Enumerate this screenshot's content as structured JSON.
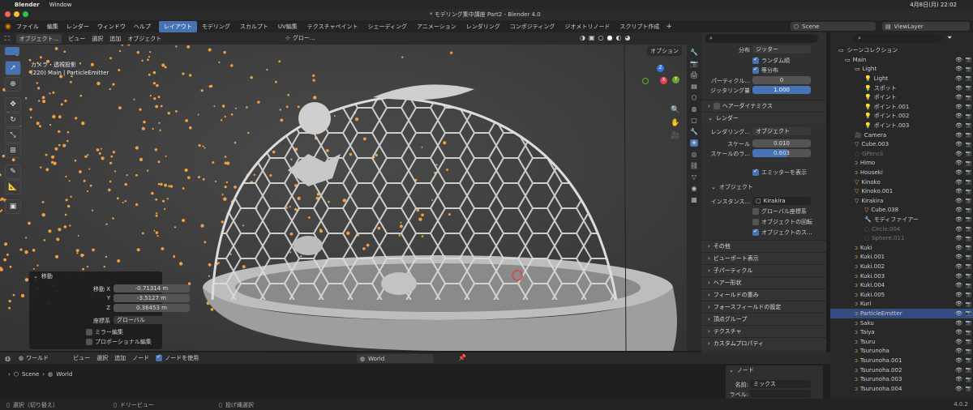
{
  "macbar": {
    "app": "Blender",
    "menu": "Window",
    "clock": "4月8日(月) 22:02"
  },
  "title": "* モデリング集中講座 Part2 - Blender 4.0",
  "topmenu": [
    "ファイル",
    "編集",
    "レンダー",
    "ウィンドウ",
    "ヘルプ"
  ],
  "workspaces": [
    "レイアウト",
    "モデリング",
    "スカルプト",
    "UV編集",
    "テクスチャペイント",
    "シェーディング",
    "アニメーション",
    "レンダリング",
    "コンポジティング",
    "ジオメトリノード",
    "スクリプト作成"
  ],
  "active_workspace": "レイアウト",
  "scene": "Scene",
  "viewlayer": "ViewLayer",
  "viewport": {
    "mode": "オブジェクト...",
    "menu": [
      "ビュー",
      "選択",
      "追加",
      "オブジェクト"
    ],
    "transform": "グロー...",
    "overlay_label": "オプション",
    "info1": "カメラ・透視投影",
    "info2": "(220) Main | ParticleEmitter",
    "gizmo_x": "X",
    "gizmo_y": "Y",
    "gizmo_z": "Z"
  },
  "redo": {
    "title": "移動",
    "label_move": "移動 X",
    "x": "-0.71314 m",
    "label_y": "Y",
    "y": "-3.5127 m",
    "label_z": "Z",
    "z": "0.36453 m",
    "orient_label": "座標系",
    "orient": "グローバル",
    "mirror": "ミラー編集",
    "proportional": "プロポーショナル編集"
  },
  "props": {
    "dist_label": "分布",
    "dist": "ジッター",
    "random": "ランダム順",
    "even": "等分布",
    "per_label": "パーティクル...",
    "per_val": "0",
    "jitter_label": "ジッタリング量",
    "jitter_val": "1.000",
    "hair": "ヘアーダイナミクス",
    "render": "レンダー",
    "renderas_label": "レンダリング...",
    "renderas": "オブジェクト",
    "scale_label": "スケール",
    "scale_val": "0.010",
    "scalernd_label": "スケールのラ...",
    "scalernd_val": "0.603",
    "show_emitter": "エミッターを表示",
    "object_sec": "オブジェクト",
    "inst_label": "インスタンス...",
    "inst_val": "Kirakira",
    "global": "グローバル座標系",
    "rotation": "オブジェクトの回転",
    "objscale": "オブジェクトのス...",
    "panels": [
      "その他",
      "ビューポート表示",
      "子パーティクル",
      "ヘアー形状",
      "フィールドの重み",
      "フォースフィールドの設定",
      "頂点グループ",
      "テクスチャ",
      "カスタムプロパティ"
    ]
  },
  "outliner": {
    "root": "シーンコレクション",
    "rows": [
      {
        "t": "Main",
        "d": 0,
        "k": "col"
      },
      {
        "t": "Light",
        "d": 1,
        "k": "col"
      },
      {
        "t": "Light",
        "d": 2,
        "k": "lt"
      },
      {
        "t": "スポット",
        "d": 2,
        "k": "lt"
      },
      {
        "t": "ポイント",
        "d": 2,
        "k": "lt"
      },
      {
        "t": "ポイント.001",
        "d": 2,
        "k": "lt"
      },
      {
        "t": "ポイント.002",
        "d": 2,
        "k": "lt"
      },
      {
        "t": "ポイント.003",
        "d": 2,
        "k": "lt"
      },
      {
        "t": "Camera",
        "d": 1,
        "k": "cam"
      },
      {
        "t": "Cube.003",
        "d": 1,
        "k": "obj"
      },
      {
        "t": "GPencil",
        "d": 1,
        "k": "dim"
      },
      {
        "t": "Himo",
        "d": 1,
        "k": "crv"
      },
      {
        "t": "Houseki",
        "d": 1,
        "k": "crv"
      },
      {
        "t": "Kinoko",
        "d": 1,
        "k": "obj"
      },
      {
        "t": "Kinoko.001",
        "d": 1,
        "k": "obj"
      },
      {
        "t": "Kirakira",
        "d": 1,
        "k": "obj"
      },
      {
        "t": "Cube.038",
        "d": 2,
        "k": "obj"
      },
      {
        "t": "モディファイアー",
        "d": 2,
        "k": "mod"
      },
      {
        "t": "Circle.004",
        "d": 2,
        "k": "dim"
      },
      {
        "t": "Sphere.011",
        "d": 2,
        "k": "dim"
      },
      {
        "t": "Kuki",
        "d": 1,
        "k": "crv"
      },
      {
        "t": "Kuki.001",
        "d": 1,
        "k": "crv"
      },
      {
        "t": "Kuki.002",
        "d": 1,
        "k": "crv"
      },
      {
        "t": "Kuki.003",
        "d": 1,
        "k": "crv"
      },
      {
        "t": "Kuki.004",
        "d": 1,
        "k": "crv"
      },
      {
        "t": "Kuki.005",
        "d": 1,
        "k": "crv"
      },
      {
        "t": "Kuri",
        "d": 1,
        "k": "crv"
      },
      {
        "t": "ParticleEmitter",
        "d": 1,
        "k": "sel"
      },
      {
        "t": "Saku",
        "d": 1,
        "k": "crv"
      },
      {
        "t": "Taiya",
        "d": 1,
        "k": "crv"
      },
      {
        "t": "Tsuru",
        "d": 1,
        "k": "crv"
      },
      {
        "t": "Tsurunoha",
        "d": 1,
        "k": "crv"
      },
      {
        "t": "Tsurunoha.001",
        "d": 1,
        "k": "crv"
      },
      {
        "t": "Tsurunoha.002",
        "d": 1,
        "k": "crv"
      },
      {
        "t": "Tsurunoha.003",
        "d": 1,
        "k": "crv"
      },
      {
        "t": "Tsurunoha.004",
        "d": 1,
        "k": "crv"
      }
    ]
  },
  "nodebar": {
    "type": "ワールド",
    "menu": [
      "ビュー",
      "選択",
      "追加",
      "ノード"
    ],
    "use_nodes": "ノードを使用",
    "world": "World",
    "crumb_scene": "Scene",
    "crumb_world": "World"
  },
  "nodepanel": {
    "title": "ノード",
    "name_label": "名前:",
    "name_val": "ミックス",
    "label_label": "ラベル:"
  },
  "status": {
    "select": "選択（切り替え）",
    "pan": "ドリービュー",
    "lasso": "投げ縄選択",
    "version": "4.0.2"
  }
}
